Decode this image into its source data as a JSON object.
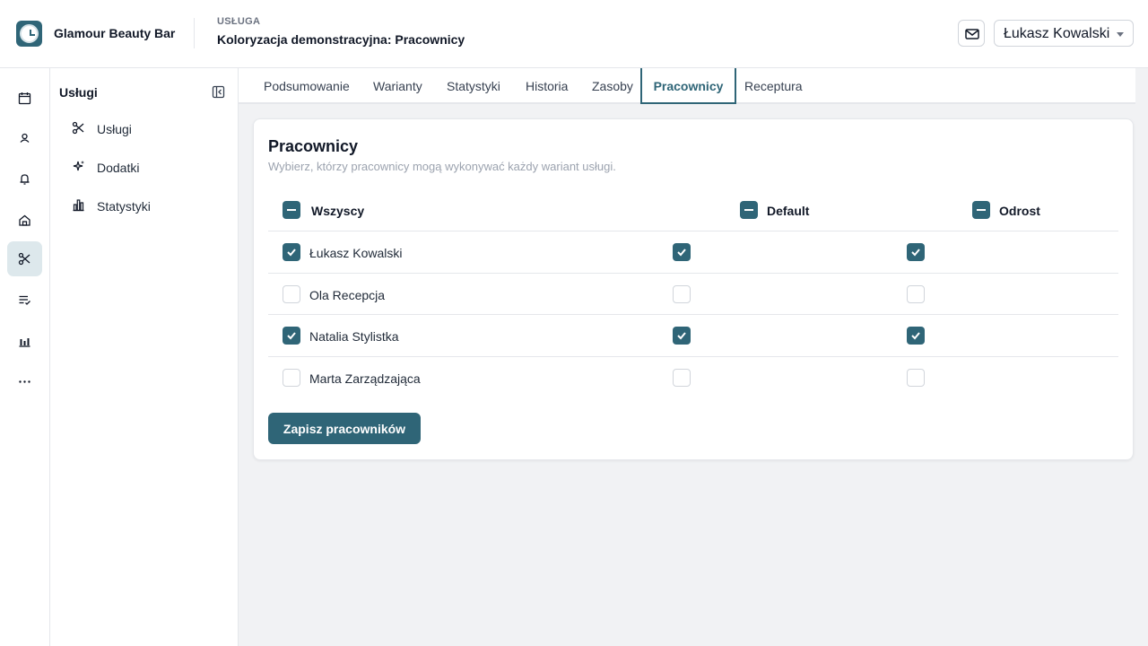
{
  "header": {
    "brand": "Glamour Beauty Bar",
    "service_eyebrow": "USŁUGA",
    "service_title": "Koloryzacja demonstracyjna: Pracownicy",
    "user_name": "Łukasz Kowalski"
  },
  "rail": {
    "items": [
      {
        "icon": "calendar-icon"
      },
      {
        "icon": "person-icon"
      },
      {
        "icon": "bell-icon"
      },
      {
        "icon": "home-icon"
      },
      {
        "icon": "scissors-icon",
        "active": true
      },
      {
        "icon": "checklist-icon"
      },
      {
        "icon": "bar-chart-icon"
      },
      {
        "icon": "more-icon"
      }
    ]
  },
  "subnav": {
    "title": "Usługi",
    "items": [
      {
        "label": "Usługi",
        "icon": "scissors-icon"
      },
      {
        "label": "Dodatki",
        "icon": "sparkles-icon"
      },
      {
        "label": "Statystyki",
        "icon": "bar-chart-icon"
      }
    ]
  },
  "tabs": [
    {
      "label": "Podsumowanie"
    },
    {
      "label": "Warianty"
    },
    {
      "label": "Statystyki"
    },
    {
      "label": "Historia"
    },
    {
      "label": "Zasoby"
    },
    {
      "label": "Pracownicy",
      "active": true
    },
    {
      "label": "Receptura"
    }
  ],
  "card": {
    "title": "Pracownicy",
    "subtitle": "Wybierz, którzy pracownicy mogą wykonywać każdy wariant usługi.",
    "columns": {
      "all": "Wszyscy",
      "default": "Default",
      "odrost": "Odrost"
    },
    "rows": [
      {
        "name": "Łukasz Kowalski",
        "all": true,
        "default": true,
        "odrost": true
      },
      {
        "name": "Ola Recepcja",
        "all": false,
        "default": false,
        "odrost": false
      },
      {
        "name": "Natalia Stylistka",
        "all": true,
        "default": true,
        "odrost": true
      },
      {
        "name": "Marta Zarządzająca",
        "all": false,
        "default": false,
        "odrost": false
      }
    ],
    "save_label": "Zapisz pracowników"
  },
  "colors": {
    "accent": "#2f6577",
    "background": "#f1f2f4"
  }
}
